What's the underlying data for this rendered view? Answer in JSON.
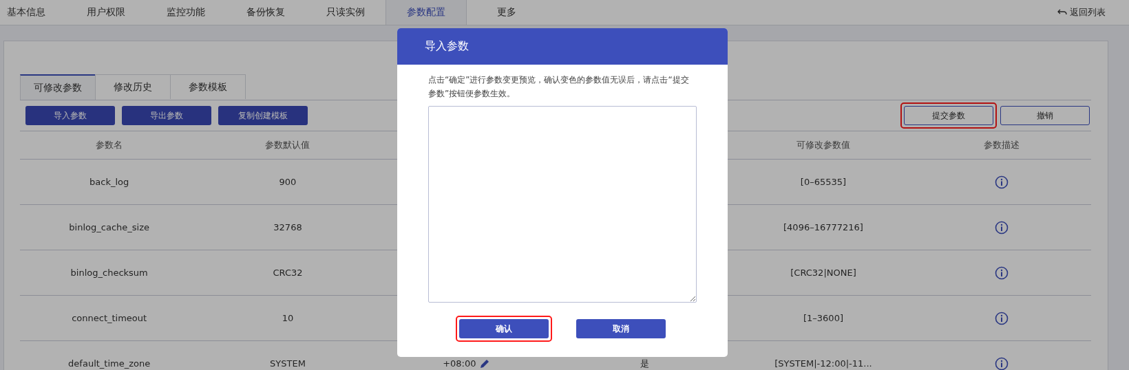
{
  "nav_tabs": [
    {
      "label": "基本信息",
      "selected": false
    },
    {
      "label": "用户权限",
      "selected": false
    },
    {
      "label": "监控功能",
      "selected": false
    },
    {
      "label": "备份恢复",
      "selected": false
    },
    {
      "label": "只读实例",
      "selected": false
    },
    {
      "label": "参数配置",
      "selected": true
    },
    {
      "label": "更多",
      "selected": false
    }
  ],
  "back_link": "返回列表",
  "sub_tabs": [
    {
      "label": "可修改参数",
      "selected": true
    },
    {
      "label": "修改历史",
      "selected": false
    },
    {
      "label": "参数模板",
      "selected": false
    }
  ],
  "left_buttons": [
    "导入参数",
    "导出参数",
    "复制创建模板"
  ],
  "right_buttons": [
    {
      "label": "提交参数",
      "highlighted": true
    },
    {
      "label": "撤销",
      "highlighted": false
    }
  ],
  "table": {
    "columns": [
      "参数名",
      "参数默认值",
      "可修改参数值",
      "参数描述"
    ],
    "rows": [
      {
        "name": "back_log",
        "default": "900",
        "range": "[0–65535]"
      },
      {
        "name": "binlog_cache_size",
        "default": "32768",
        "range": "[4096–16777216]"
      },
      {
        "name": "binlog_checksum",
        "default": "CRC32",
        "range": "[CRC32|NONE]"
      },
      {
        "name": "connect_timeout",
        "default": "10",
        "range": "[1–3600]"
      },
      {
        "name": "default_time_zone",
        "default": "SYSTEM",
        "column_3": "+08:00",
        "editable": true,
        "column_4": "是",
        "range": "[SYSTEM|-12:00|-11..."
      }
    ]
  },
  "dialog": {
    "title": "导入参数",
    "hint": "点击“确定”进行参数变更预览，确认变色的参数值无误后，请点击“提交参数”按钮便参数生效。",
    "buttons": [
      {
        "label": "确认",
        "highlighted": true
      },
      {
        "label": "取消",
        "highlighted": false
      }
    ]
  }
}
